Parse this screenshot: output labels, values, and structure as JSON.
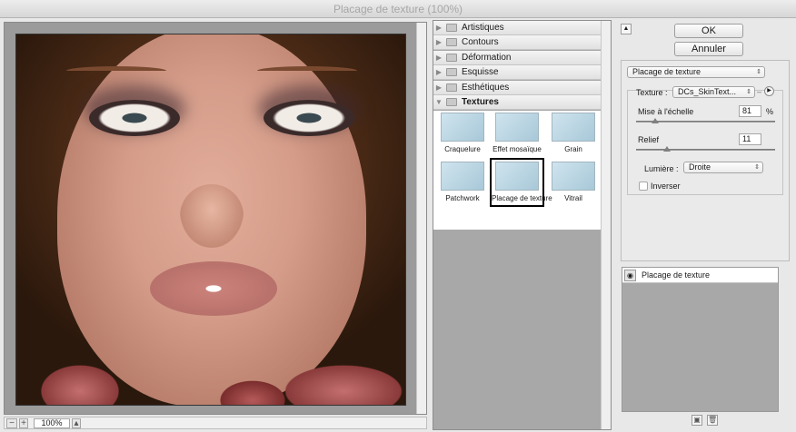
{
  "window": {
    "title": "Placage de texture (100%)"
  },
  "preview": {
    "zoom": "100%"
  },
  "gallery": {
    "categories": [
      {
        "label": "Artistiques"
      },
      {
        "label": "Contours"
      },
      {
        "label": "Déformation"
      },
      {
        "label": "Esquisse"
      },
      {
        "label": "Esthétiques"
      },
      {
        "label": "Textures"
      }
    ],
    "filters": [
      {
        "label": "Craquelure"
      },
      {
        "label": "Effet mosaïque"
      },
      {
        "label": "Grain"
      },
      {
        "label": "Patchwork"
      },
      {
        "label": "Placage de texture",
        "selected": true
      },
      {
        "label": "Vitrail"
      }
    ]
  },
  "buttons": {
    "ok": "OK",
    "cancel": "Annuler"
  },
  "settings": {
    "filter_select": "Placage de texture",
    "texture_label": "Texture :",
    "texture_value": "DCs_SkinText...",
    "scale_label": "Mise à l'échelle",
    "scale_value": "81",
    "scale_unit": "%",
    "scale_fraction": 0.14,
    "relief_label": "Relief",
    "relief_value": "11",
    "relief_fraction": 0.22,
    "light_label": "Lumière :",
    "light_value": "Droite",
    "invert_label": "Inverser",
    "invert_checked": false
  },
  "layers": {
    "item": "Placage de texture"
  }
}
